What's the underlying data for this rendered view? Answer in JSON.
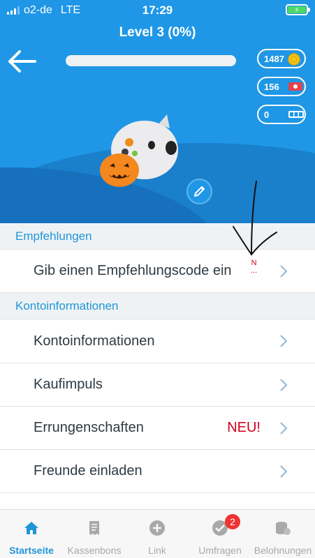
{
  "status_bar": {
    "carrier": "o2-de",
    "network": "LTE",
    "time": "17:29"
  },
  "header": {
    "level_title": "Level 3 (0%)",
    "progress_fraction": 0,
    "balances": [
      {
        "value": "1487",
        "icon": "coin-icon"
      },
      {
        "value": "156",
        "icon": "ticket-icon"
      },
      {
        "value": "0",
        "icon": "scratch-card-icon"
      }
    ]
  },
  "sections": {
    "empfehlungen": {
      "title": "Empfehlungen",
      "rows": [
        {
          "label": "Gib einen Empfehlungscode ein",
          "note": "N\n..."
        }
      ]
    },
    "konto": {
      "title": "Kontoinformationen",
      "rows": [
        {
          "label": "Kontoinformationen"
        },
        {
          "label": "Kaufimpuls"
        },
        {
          "label": "Errungenschaften",
          "badge": "NEU!"
        },
        {
          "label": "Freunde einladen"
        }
      ]
    }
  },
  "tabbar": {
    "tabs": [
      {
        "label": "Startseite",
        "icon": "home-icon",
        "active": true
      },
      {
        "label": "Kassenbons",
        "icon": "receipt-icon"
      },
      {
        "label": "Link",
        "icon": "plus-circle-icon"
      },
      {
        "label": "Umfragen",
        "icon": "check-circle-icon",
        "badge": "2"
      },
      {
        "label": "Belohnungen",
        "icon": "coins-stack-icon"
      }
    ]
  },
  "colors": {
    "primary_blue": "#1f97e6",
    "accent_red": "#d0021b",
    "tab_active": "#2196d6"
  }
}
